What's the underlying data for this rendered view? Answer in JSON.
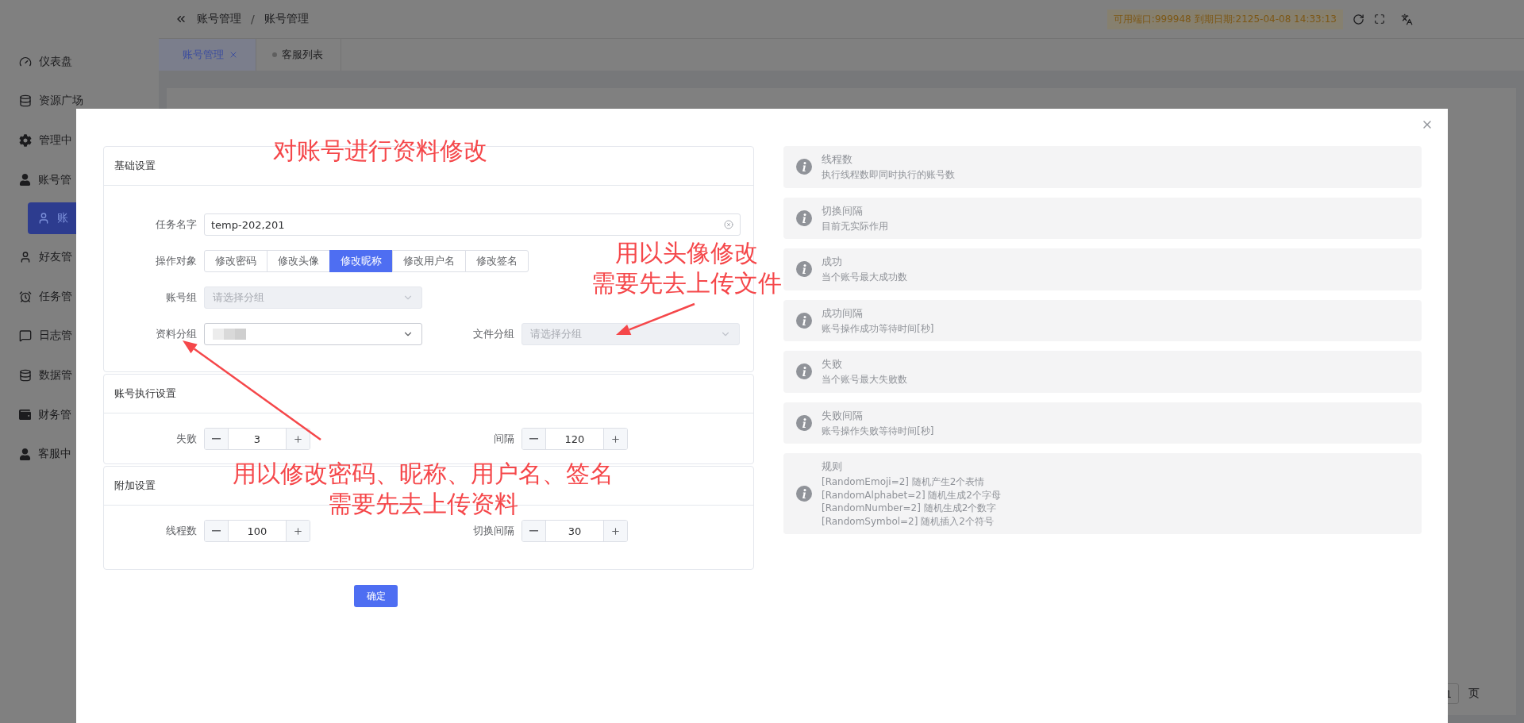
{
  "sidebar": {
    "items": [
      {
        "label": "仪表盘",
        "selected": false
      },
      {
        "label": "资源广场",
        "selected": false
      },
      {
        "label": "管理中",
        "selected": false
      },
      {
        "label": "账号管",
        "selected": false,
        "children": [
          {
            "label": "账",
            "selected": true
          }
        ]
      },
      {
        "label": "好友管",
        "selected": false
      },
      {
        "label": "任务管",
        "selected": false
      },
      {
        "label": "日志管",
        "selected": false
      },
      {
        "label": "数据管",
        "selected": false
      },
      {
        "label": "财务管",
        "selected": false
      },
      {
        "label": "客服中",
        "selected": false
      }
    ]
  },
  "header": {
    "breadcrumb": [
      "账号管理",
      "账号管理"
    ],
    "separator": "/",
    "license": "可用端口:999948 到期日期:2125-04-08 14:33:13"
  },
  "tabs": [
    {
      "label": "账号管理",
      "selected": true
    },
    {
      "label": "客服列表",
      "selected": false
    }
  ],
  "pager": {
    "page": "1",
    "unit": "页"
  },
  "modal": {
    "form_sections": [
      {
        "title": "基础设置",
        "rows": [
          {
            "fields": [
              {
                "kind": "text",
                "label": "任务名字",
                "value": "temp-202,201"
              }
            ]
          },
          {
            "fields": [
              {
                "kind": "segmented",
                "label": "操作对象",
                "options": [
                  {
                    "label": "修改密码",
                    "selected": false
                  },
                  {
                    "label": "修改头像",
                    "selected": false
                  },
                  {
                    "label": "修改昵称",
                    "selected": true
                  },
                  {
                    "label": "修改用户名",
                    "selected": false
                  },
                  {
                    "label": "修改签名",
                    "selected": false
                  }
                ]
              }
            ]
          },
          {
            "fields": [
              {
                "kind": "select",
                "label": "账号组",
                "placeholder": "请选择分组",
                "disabled": true
              }
            ]
          },
          {
            "fields": [
              {
                "kind": "select",
                "label": "资料分组",
                "blurred": true,
                "disabled": false
              },
              {
                "kind": "select",
                "label": "文件分组",
                "placeholder": "请选择分组",
                "disabled": true
              }
            ]
          }
        ]
      },
      {
        "title": "账号执行设置",
        "rows": [
          {
            "fields": [
              {
                "kind": "number",
                "label": "失败",
                "value": "3"
              },
              {
                "kind": "number",
                "label": "间隔",
                "value": "120"
              }
            ]
          }
        ]
      },
      {
        "title": "附加设置",
        "rows": [
          {
            "fields": [
              {
                "kind": "number",
                "label": "线程数",
                "value": "100"
              },
              {
                "kind": "number",
                "label": "切换间隔",
                "value": "30"
              }
            ]
          }
        ]
      }
    ],
    "submit": "确定",
    "tips": [
      {
        "title": "线程数",
        "lines": [
          "执行线程数即同时执行的账号数"
        ]
      },
      {
        "title": "切换间隔",
        "lines": [
          "目前无实际作用"
        ]
      },
      {
        "title": "成功",
        "lines": [
          "当个账号最大成功数"
        ]
      },
      {
        "title": "成功间隔",
        "lines": [
          "账号操作成功等待时间[秒]"
        ]
      },
      {
        "title": "失败",
        "lines": [
          "当个账号最大失败数"
        ]
      },
      {
        "title": "失败间隔",
        "lines": [
          "账号操作失败等待时间[秒]"
        ]
      },
      {
        "title": "规则",
        "lines": [
          "[RandomEmoji=2] 随机产生2个表情",
          "[RandomAlphabet=2] 随机生成2个字母",
          "[RandomNumber=2] 随机生成2个数字",
          "[RandomSymbol=2] 随机插入2个符号"
        ]
      }
    ],
    "annotations": [
      {
        "lines": [
          "对账号进行资料修改"
        ]
      },
      {
        "lines": [
          "用以头像修改",
          "需要先去上传文件"
        ]
      },
      {
        "lines": [
          "用以修改密码、昵称、用户名、签名",
          "需要先去上传资料"
        ]
      }
    ]
  }
}
